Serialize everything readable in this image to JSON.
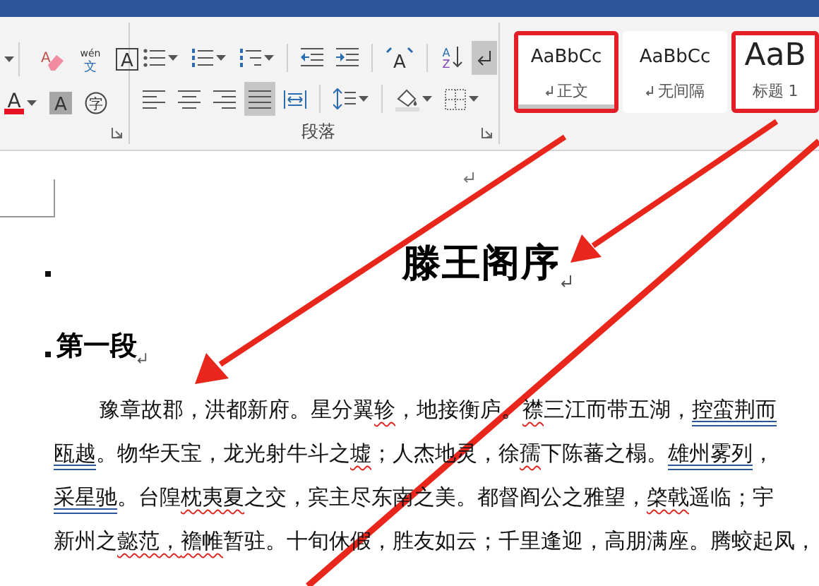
{
  "ribbon": {
    "groups": [
      {
        "kind": "font",
        "rows": [
          [
            {
              "kind": "caret"
            },
            {
              "kind": "clear-format",
              "text": "A"
            },
            {
              "kind": "phonetic",
              "text": "wén",
              "sub": "文"
            },
            {
              "kind": "boxed",
              "text": "A"
            }
          ],
          [
            {
              "kind": "font-color",
              "text": "A",
              "color": "#e81123"
            },
            {
              "kind": "highlighted-char",
              "text": "A"
            },
            {
              "kind": "enclosed",
              "text": "字"
            }
          ]
        ]
      },
      {
        "kind": "paragraph",
        "label": "段落",
        "rows": [
          [
            {
              "kind": "bullets"
            },
            {
              "kind": "numbering"
            },
            {
              "kind": "multilevel"
            },
            {
              "kind": "separator"
            },
            {
              "kind": "decrease-indent"
            },
            {
              "kind": "increase-indent"
            },
            {
              "kind": "separator"
            },
            {
              "kind": "text-direction",
              "text": "A"
            },
            {
              "kind": "separator"
            },
            {
              "kind": "sort",
              "text": "A",
              "sub": "Z"
            },
            {
              "kind": "show-marks",
              "on": true
            }
          ],
          [
            {
              "kind": "align-left",
              "selected": false
            },
            {
              "kind": "align-center",
              "selected": false
            },
            {
              "kind": "align-right",
              "selected": false
            },
            {
              "kind": "justify",
              "selected": true
            },
            {
              "kind": "distributed",
              "selected": false
            },
            {
              "kind": "separator"
            },
            {
              "kind": "line-spacing"
            },
            {
              "kind": "separator"
            },
            {
              "kind": "shading"
            },
            {
              "kind": "borders"
            }
          ]
        ]
      }
    ],
    "styles": [
      {
        "kind": "normal",
        "preview": "AaBbCc",
        "name": "正文",
        "selected": true,
        "annotated": true
      },
      {
        "kind": "normal",
        "preview": "AaBbCc",
        "name": "无间隔",
        "selected": false,
        "annotated": false
      },
      {
        "kind": "heading",
        "preview": "AaB",
        "name": "标题 1",
        "selected": false,
        "annotated": true
      }
    ]
  },
  "document": {
    "title": "滕王阁序",
    "heading": "第一段",
    "paragraph": [
      [
        {
          "text": "豫章故郡，洪都新府。星分翼"
        },
        {
          "text": "轸",
          "misspelled": true
        },
        {
          "text": "，地接衡庐。"
        },
        {
          "text": "襟",
          "misspelled": true
        },
        {
          "text": "三江而带五湖，"
        },
        {
          "text": "控蛮荆而",
          "grammar_flag": true
        }
      ],
      [
        {
          "text": "瓯越",
          "grammar_flag": true
        },
        {
          "text": "。物华天宝，龙光射牛斗之"
        },
        {
          "text": "墟",
          "misspelled": true
        },
        {
          "text": "；人杰地灵，徐"
        },
        {
          "text": "孺",
          "misspelled": true
        },
        {
          "text": "下陈蕃之榻。"
        },
        {
          "text": "雄州雾列",
          "grammar_flag": true
        },
        {
          "text": "，"
        }
      ],
      [
        {
          "text": "采星驰",
          "grammar_flag": true
        },
        {
          "text": "。台隍"
        },
        {
          "text": "枕夷夏",
          "misspelled": true
        },
        {
          "text": "之交，宾主尽东南之美。都督阎公之雅望，"
        },
        {
          "text": "棨戟",
          "misspelled": true
        },
        {
          "text": "遥临；宇"
        }
      ],
      [
        {
          "text": "新州之"
        },
        {
          "text": "懿范，",
          "misspelled": true
        },
        {
          "text": "襜帷",
          "misspelled": true
        },
        {
          "text": "暂驻。十旬休假，胜友如云；千里逢迎，高朋满座。腾蛟起凤，"
        }
      ]
    ]
  }
}
